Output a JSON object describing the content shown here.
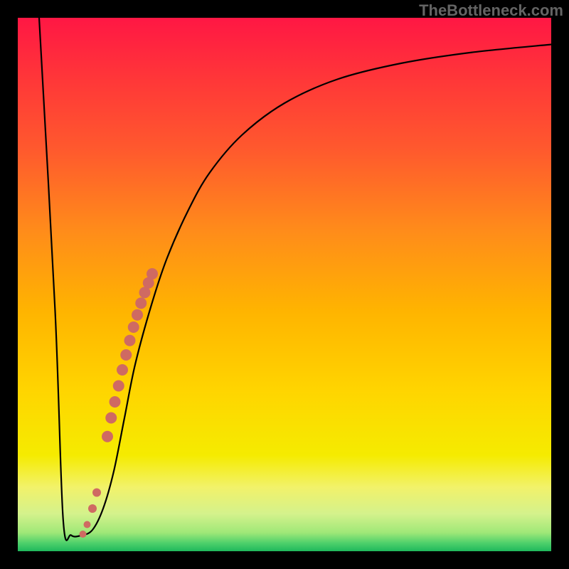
{
  "attribution": "TheBottleneck.com",
  "chart_data": {
    "type": "line",
    "title": "",
    "xlabel": "",
    "ylabel": "",
    "xlim": [
      0,
      100
    ],
    "ylim": [
      0,
      100
    ],
    "gradient_stops": [
      {
        "offset": 0.0,
        "color": "#ff1744"
      },
      {
        "offset": 0.12,
        "color": "#ff3838"
      },
      {
        "offset": 0.25,
        "color": "#ff5a2d"
      },
      {
        "offset": 0.4,
        "color": "#ff8c1a"
      },
      {
        "offset": 0.55,
        "color": "#ffb400"
      },
      {
        "offset": 0.7,
        "color": "#ffd500"
      },
      {
        "offset": 0.82,
        "color": "#f5eb00"
      },
      {
        "offset": 0.88,
        "color": "#f2f26a"
      },
      {
        "offset": 0.93,
        "color": "#d4f28c"
      },
      {
        "offset": 0.965,
        "color": "#a0e878"
      },
      {
        "offset": 0.985,
        "color": "#4dd06b"
      },
      {
        "offset": 1.0,
        "color": "#1fb85c"
      }
    ],
    "series": [
      {
        "name": "bottleneck-curve",
        "x": [
          4,
          7,
          8.5,
          10,
          12,
          14,
          16,
          18,
          20,
          22,
          25,
          28,
          32,
          36,
          42,
          50,
          60,
          72,
          85,
          100
        ],
        "y": [
          100,
          45,
          6,
          3,
          3,
          4,
          8,
          15,
          25,
          35,
          46,
          55,
          64,
          71,
          78,
          84,
          88.5,
          91.5,
          93.5,
          95
        ]
      }
    ],
    "markers": [
      {
        "name": "dot-cluster",
        "type": "scatter",
        "x": [
          12.2,
          13.0,
          14.0,
          14.8,
          16.8,
          17.5,
          18.2,
          18.9,
          19.6,
          20.3,
          21.0,
          21.7,
          22.4,
          23.1,
          23.8,
          24.5,
          25.2
        ],
        "y": [
          3.2,
          5.0,
          8.0,
          11.0,
          21.5,
          25.0,
          28.0,
          31.0,
          34.0,
          36.8,
          39.5,
          42.0,
          44.3,
          46.5,
          48.5,
          50.3,
          52.0
        ],
        "r": [
          5,
          5,
          6,
          6,
          8,
          8,
          8,
          8,
          8,
          8,
          8,
          8,
          8,
          8,
          8,
          8,
          8
        ],
        "color": "#cf6a62"
      }
    ]
  }
}
